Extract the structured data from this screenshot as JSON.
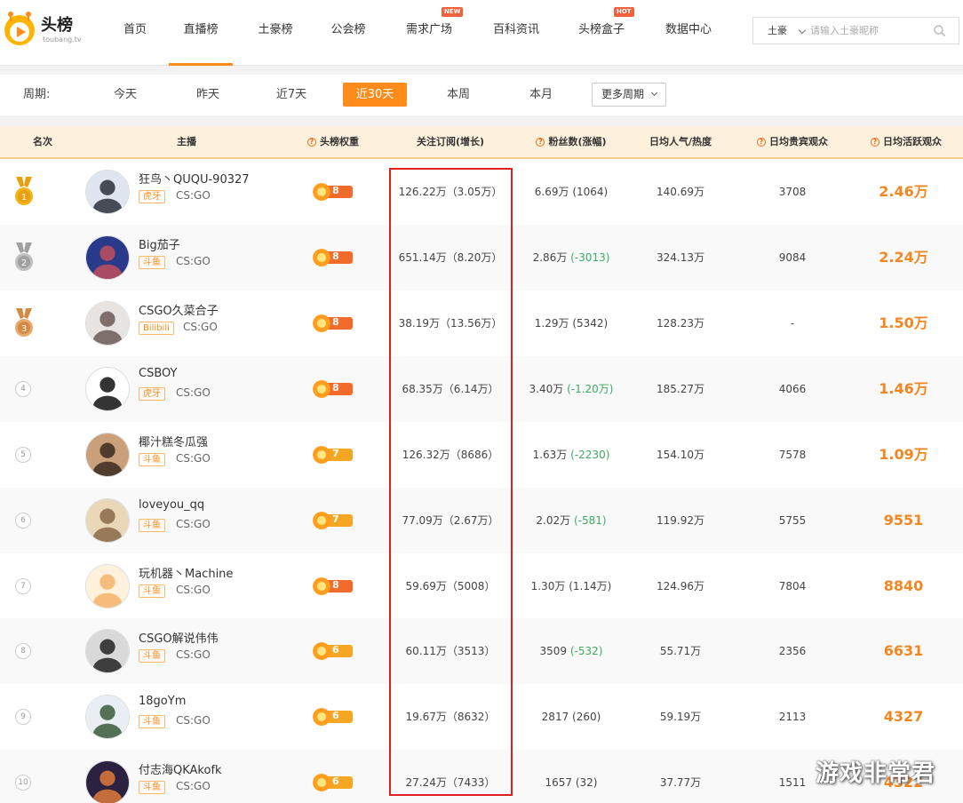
{
  "logo": {
    "text": "头榜",
    "sub": "toubang.tv"
  },
  "nav": [
    {
      "label": "首页"
    },
    {
      "label": "直播榜",
      "active": true
    },
    {
      "label": "土豪榜"
    },
    {
      "label": "公会榜"
    },
    {
      "label": "需求广场",
      "badge": "NEW"
    },
    {
      "label": "百科资讯"
    },
    {
      "label": "头榜盒子",
      "badge": "HOT"
    },
    {
      "label": "数据中心"
    }
  ],
  "search": {
    "type": "土豪",
    "placeholder": "请输入土豪昵称",
    "icon": "search-icon"
  },
  "period": {
    "label": "周期:",
    "options": [
      "今天",
      "昨天",
      "近7天",
      "近30天",
      "本周",
      "本月"
    ],
    "active": "近30天",
    "more": "更多周期"
  },
  "table": {
    "headers": {
      "rank": "名次",
      "anchor": "主播",
      "weight": "头榜权重",
      "subs": "关注订阅(增长)",
      "fans": "粉丝数(涨幅)",
      "popularity": "日均人气/热度",
      "vip": "日均贵宾观众",
      "active": "日均活跃观众"
    },
    "rows": [
      {
        "rank": "1",
        "name": "狂鸟丶QUQU-90327",
        "platform": "虎牙",
        "game": "CS:GO",
        "weight": "8",
        "subs": "126.22万（3.05万）",
        "fans": "6.69万",
        "fans_delta": "(1064)",
        "fans_neg": false,
        "popularity": "140.69万",
        "vip": "3708",
        "active": "2.46万"
      },
      {
        "rank": "2",
        "name": "Big茄子",
        "platform": "斗鱼",
        "game": "CS:GO",
        "weight": "8",
        "subs": "651.14万（8.20万）",
        "fans": "2.86万",
        "fans_delta": "(-3013)",
        "fans_neg": true,
        "popularity": "324.13万",
        "vip": "9084",
        "active": "2.24万"
      },
      {
        "rank": "3",
        "name": "CSGO久菜合子",
        "platform": "Bilibili",
        "game": "CS:GO",
        "weight": "8",
        "subs": "38.19万（13.56万）",
        "fans": "1.29万",
        "fans_delta": "(5342)",
        "fans_neg": false,
        "popularity": "128.23万",
        "vip": "-",
        "active": "1.50万"
      },
      {
        "rank": "4",
        "name": "CSBOY",
        "platform": "虎牙",
        "game": "CS:GO",
        "weight": "8",
        "subs": "68.35万（6.14万）",
        "fans": "3.40万",
        "fans_delta": "(-1.20万)",
        "fans_neg": true,
        "popularity": "185.27万",
        "vip": "4066",
        "active": "1.46万"
      },
      {
        "rank": "5",
        "name": "椰汁糕冬瓜强",
        "platform": "斗鱼",
        "game": "CS:GO",
        "weight": "7",
        "subs": "126.32万（8686）",
        "fans": "1.63万",
        "fans_delta": "(-2230)",
        "fans_neg": true,
        "popularity": "154.10万",
        "vip": "7578",
        "active": "1.09万"
      },
      {
        "rank": "6",
        "name": "loveyou_qq",
        "platform": "斗鱼",
        "game": "CS:GO",
        "weight": "7",
        "subs": "77.09万（2.67万）",
        "fans": "2.02万",
        "fans_delta": "(-581)",
        "fans_neg": true,
        "popularity": "119.92万",
        "vip": "5755",
        "active": "9551"
      },
      {
        "rank": "7",
        "name": "玩机器丶Machine",
        "platform": "斗鱼",
        "game": "CS:GO",
        "weight": "8",
        "subs": "59.69万（5008）",
        "fans": "1.30万",
        "fans_delta": "(1.14万)",
        "fans_neg": false,
        "popularity": "124.96万",
        "vip": "7804",
        "active": "8840"
      },
      {
        "rank": "8",
        "name": "CSGO解说伟伟",
        "platform": "斗鱼",
        "game": "CS:GO",
        "weight": "6",
        "subs": "60.11万（3513）",
        "fans": "3509",
        "fans_delta": "(-532)",
        "fans_neg": true,
        "popularity": "55.71万",
        "vip": "2356",
        "active": "6631"
      },
      {
        "rank": "9",
        "name": "18goYm",
        "platform": "斗鱼",
        "game": "CS:GO",
        "weight": "6",
        "subs": "19.67万（8632）",
        "fans": "2817",
        "fans_delta": "(260)",
        "fans_neg": false,
        "popularity": "59.19万",
        "vip": "2113",
        "active": "4327"
      },
      {
        "rank": "10",
        "name": "付志海QKAkofk",
        "platform": "斗鱼",
        "game": "CS:GO",
        "weight": "6",
        "subs": "27.24万（7433）",
        "fans": "1657",
        "fans_delta": "(32)",
        "fans_neg": false,
        "popularity": "37.77万",
        "vip": "1511",
        "active": "4322"
      }
    ]
  },
  "watermark": "游戏非常君",
  "colors": {
    "accent": "#ff8c1a",
    "negative": "#3eaa62",
    "highlight": "#e02020"
  }
}
